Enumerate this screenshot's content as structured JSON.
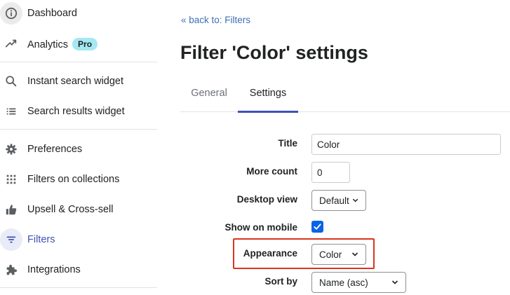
{
  "sidebar": {
    "items": [
      {
        "label": "Dashboard",
        "icon": "info-icon"
      },
      {
        "label": "Analytics",
        "icon": "trend-icon",
        "badge": "Pro"
      },
      {
        "label": "Instant search widget",
        "icon": "search-icon"
      },
      {
        "label": "Search results widget",
        "icon": "list-icon"
      },
      {
        "label": "Preferences",
        "icon": "gear-icon"
      },
      {
        "label": "Filters on collections",
        "icon": "grid-icon"
      },
      {
        "label": "Upsell & Cross-sell",
        "icon": "thumbs-up-icon"
      },
      {
        "label": "Filters",
        "icon": "filter-icon"
      },
      {
        "label": "Integrations",
        "icon": "puzzle-icon"
      }
    ]
  },
  "main": {
    "back_link": "« back to: Filters",
    "title": "Filter 'Color' settings",
    "tabs": [
      {
        "label": "General"
      },
      {
        "label": "Settings"
      }
    ],
    "form": {
      "title_label": "Title",
      "title_value": "Color",
      "more_count_label": "More count",
      "more_count_value": "0",
      "desktop_view_label": "Desktop view",
      "desktop_view_value": "Default",
      "show_on_mobile_label": "Show on mobile",
      "show_on_mobile_checked": true,
      "appearance_label": "Appearance",
      "appearance_value": "Color",
      "sort_by_label": "Sort by",
      "sort_by_value": "Name (asc)"
    }
  },
  "colors": {
    "accent": "#3f51b5",
    "link": "#3f6fb5",
    "checkbox": "#0b63e5",
    "highlight": "#d9341f",
    "badge": "#a4e8f2"
  }
}
